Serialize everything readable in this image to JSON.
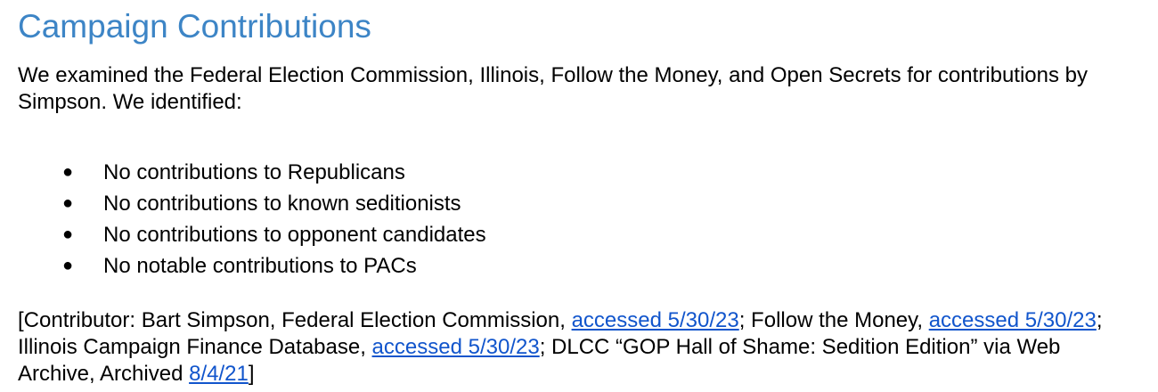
{
  "document": {
    "heading": "Campaign Contributions",
    "intro": "We examined the Federal Election Commission, Illinois, Follow the Money, and Open Secrets for contributions by Simpson. We identified:",
    "bullet_glyph": "●",
    "bullets": [
      "No contributions to Republicans",
      "No contributions to known seditionists",
      "No contributions to opponent candidates",
      "No notable contributions to PACs"
    ],
    "sources": {
      "text_1": "[Contributor: Bart Simpson, Federal Election Commission, ",
      "link_1": "accessed 5/30/23",
      "text_2": "; Follow the Money, ",
      "link_2": "accessed 5/30/23",
      "text_3": "; Illinois Campaign Finance Database, ",
      "link_3": "accessed 5/30/23",
      "text_4": "; DLCC “GOP Hall of Shame: Sedition Edition” via Web Archive, Archived ",
      "link_4": "8/4/21",
      "text_5": "]"
    }
  },
  "colors": {
    "heading": "#3d85c6",
    "link": "#1155cc",
    "text": "#000000"
  }
}
